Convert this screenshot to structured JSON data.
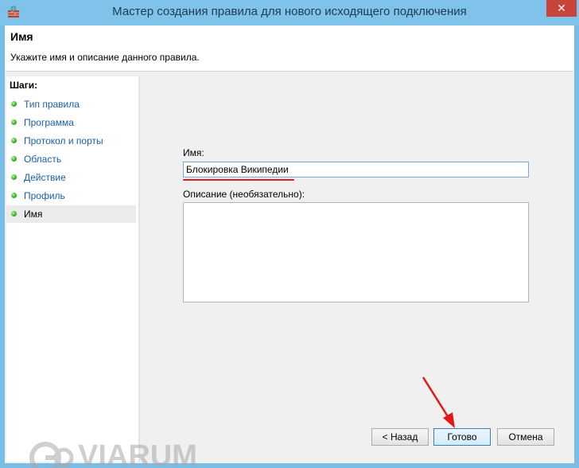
{
  "window": {
    "title": "Мастер создания правила для нового исходящего подключения",
    "close_label": "✕"
  },
  "header": {
    "title": "Имя",
    "description": "Укажите имя и описание данного правила."
  },
  "steps": {
    "title": "Шаги:",
    "items": [
      {
        "label": "Тип правила"
      },
      {
        "label": "Программа"
      },
      {
        "label": "Протокол и порты"
      },
      {
        "label": "Область"
      },
      {
        "label": "Действие"
      },
      {
        "label": "Профиль"
      },
      {
        "label": "Имя"
      }
    ],
    "active_index": 6
  },
  "form": {
    "name_label": "Имя:",
    "name_value": "Блокировка Википедии",
    "description_label": "Описание (необязательно):",
    "description_value": ""
  },
  "buttons": {
    "back": "< Назад",
    "finish": "Готово",
    "cancel": "Отмена"
  },
  "watermark": {
    "text": "VIARUM"
  },
  "colors": {
    "accent": "#7fc3ea",
    "annotation": "#e01818",
    "link": "#1a5ea8"
  }
}
